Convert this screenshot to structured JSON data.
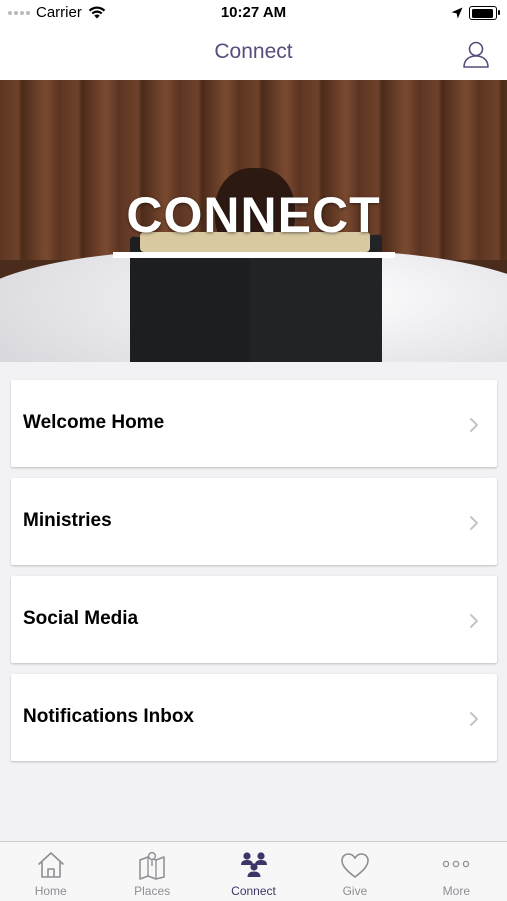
{
  "status_bar": {
    "carrier": "Carrier",
    "time": "10:27 AM"
  },
  "nav": {
    "title": "Connect",
    "accent_color": "#5b4b7c"
  },
  "hero": {
    "title": "CONNECT"
  },
  "list": {
    "items": [
      {
        "label": "Welcome Home"
      },
      {
        "label": "Ministries"
      },
      {
        "label": "Social Media"
      },
      {
        "label": "Notifications Inbox"
      }
    ]
  },
  "tab_bar": {
    "active_color": "#3f3466",
    "tabs": [
      {
        "label": "Home",
        "icon": "house-icon"
      },
      {
        "label": "Places",
        "icon": "map-icon"
      },
      {
        "label": "Connect",
        "icon": "people-icon",
        "active": true
      },
      {
        "label": "Give",
        "icon": "heart-icon"
      },
      {
        "label": "More",
        "icon": "more-icon"
      }
    ]
  }
}
